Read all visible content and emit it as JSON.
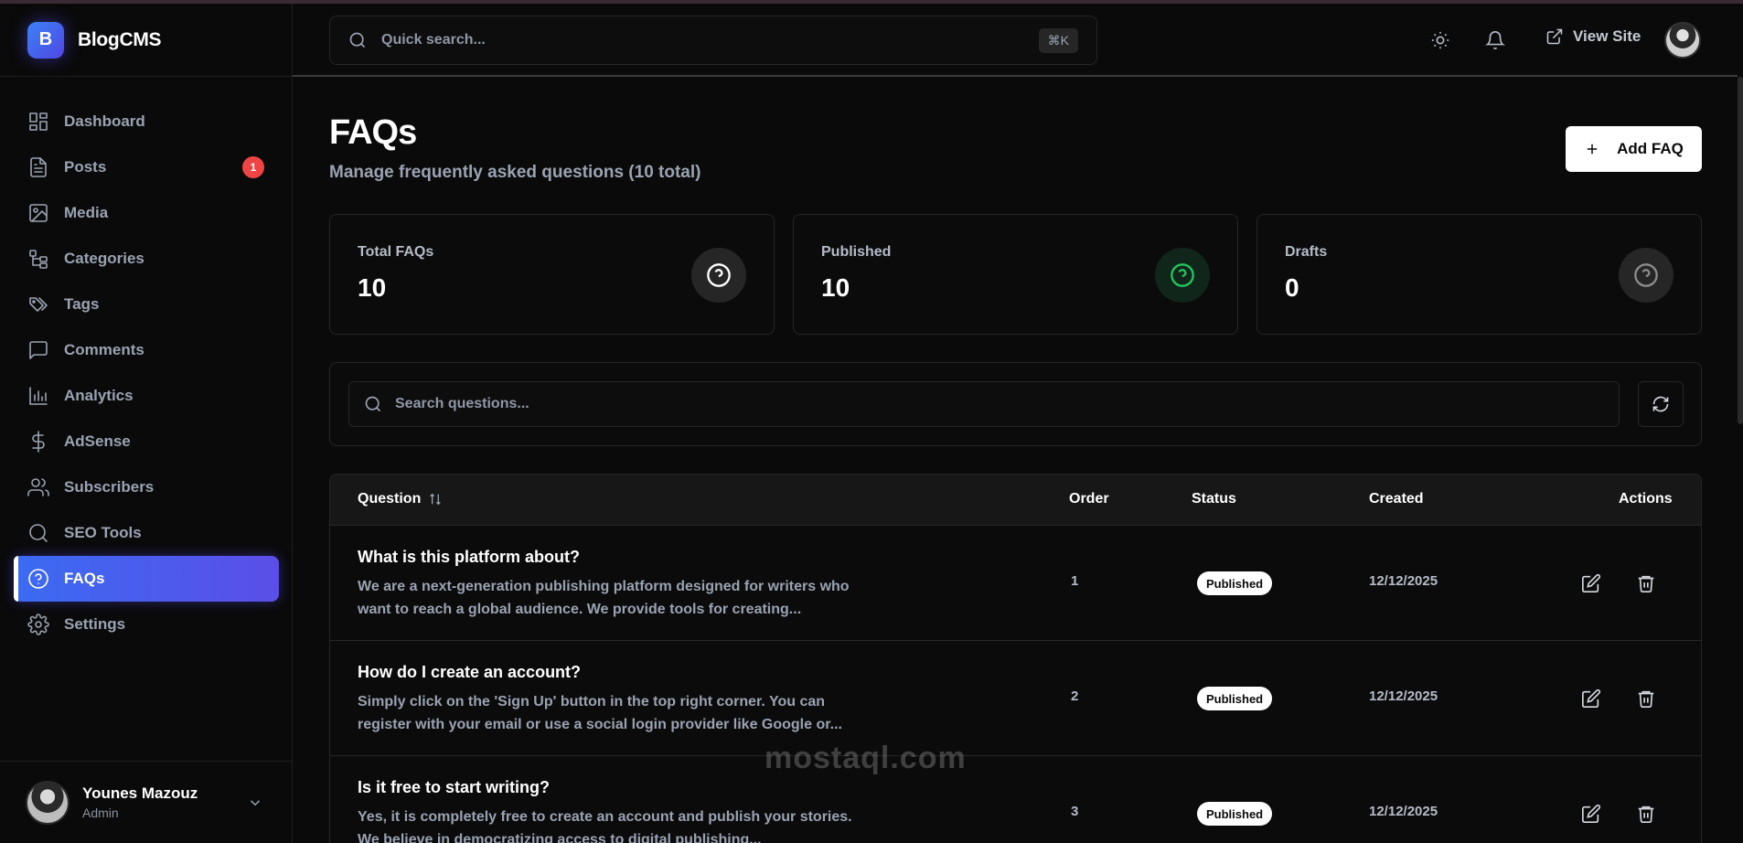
{
  "brand": {
    "logo_letter": "B",
    "name": "BlogCMS"
  },
  "sidebar": {
    "items": [
      {
        "label": "Dashboard",
        "icon": "dashboard-icon"
      },
      {
        "label": "Posts",
        "icon": "document-icon",
        "badge": "1"
      },
      {
        "label": "Media",
        "icon": "image-icon"
      },
      {
        "label": "Categories",
        "icon": "categories-icon"
      },
      {
        "label": "Tags",
        "icon": "tags-icon"
      },
      {
        "label": "Comments",
        "icon": "comment-icon"
      },
      {
        "label": "Analytics",
        "icon": "bar-chart-icon"
      },
      {
        "label": "AdSense",
        "icon": "dollar-icon"
      },
      {
        "label": "Subscribers",
        "icon": "users-icon"
      },
      {
        "label": "SEO Tools",
        "icon": "search-icon"
      },
      {
        "label": "FAQs",
        "icon": "help-circle-icon",
        "active": true
      },
      {
        "label": "Settings",
        "icon": "gear-icon"
      }
    ],
    "user": {
      "name": "Younes Mazouz",
      "role": "Admin"
    }
  },
  "header": {
    "search_placeholder": "Quick search...",
    "shortcut": "⌘K",
    "view_site_label": "View Site"
  },
  "page": {
    "title": "FAQs",
    "subtitle": "Manage frequently asked questions (10 total)",
    "add_button": "Add FAQ"
  },
  "stats": [
    {
      "label": "Total FAQs",
      "value": "10",
      "icon_color": "#ffffff"
    },
    {
      "label": "Published",
      "value": "10",
      "icon_color": "#22c55e"
    },
    {
      "label": "Drafts",
      "value": "0",
      "icon_color": "#8b8b8b"
    }
  ],
  "filter": {
    "search_placeholder": "Search questions..."
  },
  "table": {
    "columns": [
      "Question",
      "Order",
      "Status",
      "Created",
      "Actions"
    ],
    "rows": [
      {
        "question": "What is this platform about?",
        "answer": "We are a next-generation publishing platform designed for writers who want to reach a global audience. We provide tools for creating...",
        "order": "1",
        "status": "Published",
        "created": "12/12/2025"
      },
      {
        "question": "How do I create an account?",
        "answer": "Simply click on the 'Sign Up' button in the top right corner. You can register with your email or use a social login provider like Google or...",
        "order": "2",
        "status": "Published",
        "created": "12/12/2025"
      },
      {
        "question": "Is it free to start writing?",
        "answer": "Yes, it is completely free to create an account and publish your stories. We believe in democratizing access to digital publishing...",
        "order": "3",
        "status": "Published",
        "created": "12/12/2025"
      }
    ]
  },
  "watermark": "mostaql.com",
  "colors": {
    "accent": "#4f46e5",
    "badge": "#ef4444",
    "background": "#0a0a0a"
  }
}
